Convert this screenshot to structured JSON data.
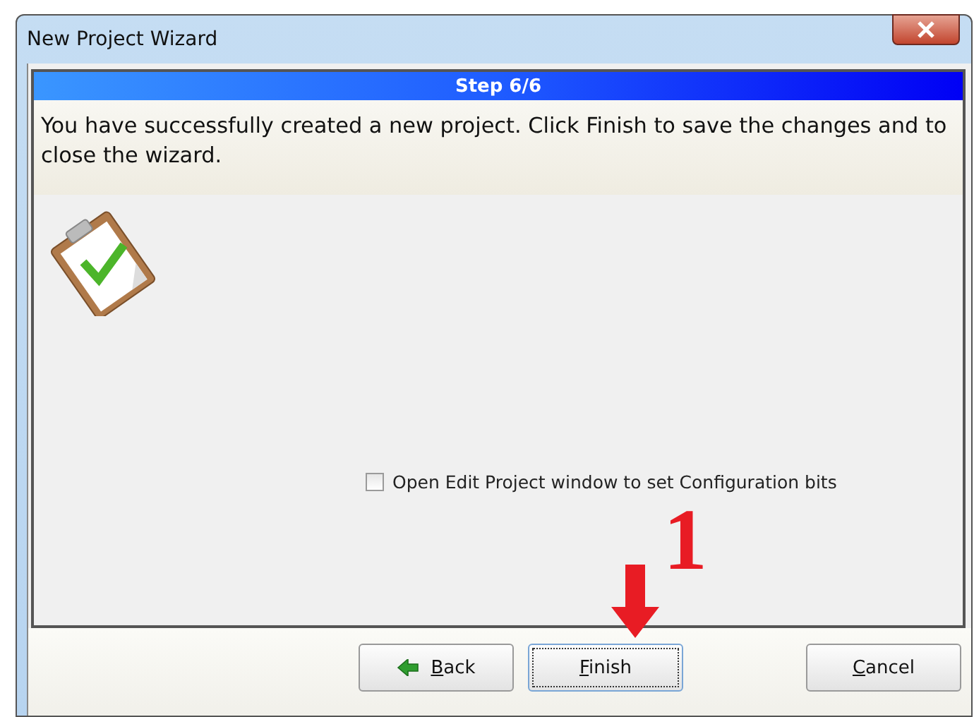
{
  "window": {
    "title": "New Project Wizard"
  },
  "step": {
    "label": "Step 6/6"
  },
  "message": "You have successfully created a new project. Click Finish to save the changes and to close the wizard.",
  "option": {
    "label": "Open Edit Project window to set Configuration bits",
    "checked": false
  },
  "annotation": {
    "text": "1"
  },
  "buttons": [
    {
      "kind": "back",
      "label": "Back",
      "underline_first": true,
      "focused": false
    },
    {
      "kind": "plain",
      "label": "Finish",
      "underline_first": true,
      "focused": true
    },
    {
      "kind": "plain",
      "label": "Cancel",
      "underline_first": true,
      "focused": false
    }
  ]
}
